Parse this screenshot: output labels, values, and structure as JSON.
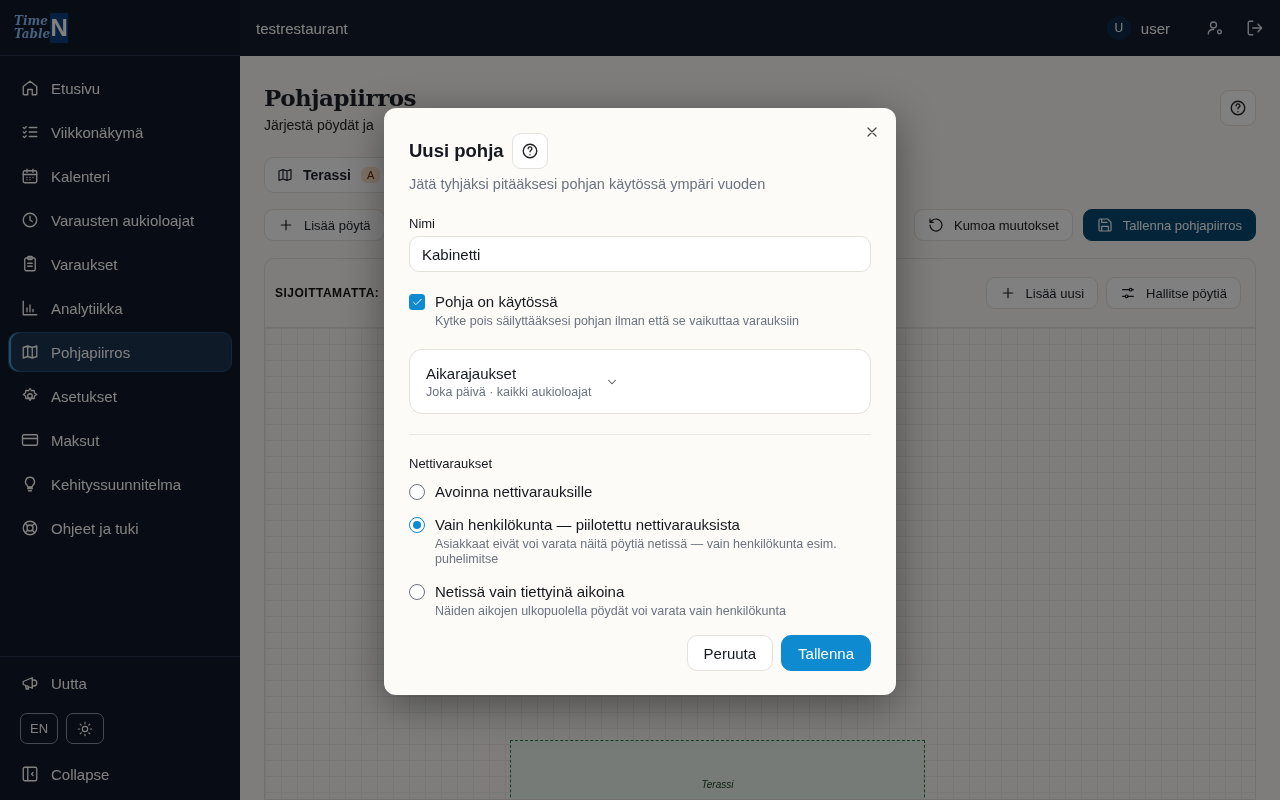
{
  "sidebar": {
    "logo": {
      "script": [
        "Time",
        "Table"
      ],
      "letter": "N"
    },
    "nav": [
      {
        "label": "Etusivu",
        "selected": false
      },
      {
        "label": "Viikkonäkymä",
        "selected": false
      },
      {
        "label": "Kalenteri",
        "selected": false
      },
      {
        "label": "Varausten aukioloajat",
        "selected": false
      },
      {
        "label": "Varaukset",
        "selected": false
      },
      {
        "label": "Analytiikka",
        "selected": false
      },
      {
        "label": "Pohjapiirros",
        "selected": true
      },
      {
        "label": "Asetukset",
        "selected": false
      },
      {
        "label": "Maksut",
        "selected": false
      },
      {
        "label": "Kehityssuunnitelma",
        "selected": false
      },
      {
        "label": "Ohjeet ja tuki",
        "selected": false
      }
    ],
    "footer": {
      "news": "Uutta",
      "language": "EN",
      "collapse": "Collapse"
    }
  },
  "topbar": {
    "restaurant": "testrestaurant",
    "avatar": "U",
    "user": "user"
  },
  "page": {
    "title": "Pohjapiirros",
    "subtitle": "Järjestä pöydät ja",
    "floor_tab": {
      "label": "Terassi",
      "badge": "A"
    },
    "toolbar": {
      "add_table": "Lisää pöytä",
      "undo": "Kumoa muutokset",
      "save": "Tallenna pohjapiirros"
    },
    "panel": {
      "unplaced": "SIJOITTAMATTA:",
      "add_new": "Lisää uusi",
      "manage": "Hallitse pöytiä",
      "zone": "Terassi"
    }
  },
  "dialog": {
    "title": "Uusi pohja",
    "description": "Jätä tyhjäksi pitääksesi pohjan käytössä ympäri vuoden",
    "name_label": "Nimi",
    "name_value": "Kabinetti",
    "enabled": {
      "label": "Pohja on käytössä",
      "hint": "Kytke pois säilyttääksesi pohjan ilman että se vaikuttaa varauksiin",
      "checked": true
    },
    "time_limits": {
      "title": "Aikarajaukset",
      "summary": "Joka päivä · kaikki aukioloajat",
      "expanded": false
    },
    "online": {
      "title": "Nettivaraukset",
      "options": [
        {
          "label": "Avoinna nettivarauksille",
          "selected": false
        },
        {
          "label": "Vain henkilökunta — piilotettu nettivarauksista",
          "hint": "Asiakkaat eivät voi varata näitä pöytiä netissä — vain henkilökunta esim. puhelimitse",
          "selected": true
        },
        {
          "label": "Netissä vain tiettyinä aikoina",
          "hint": "Näiden aikojen ulkopuolella pöydät voi varata vain henkilökunta",
          "selected": false
        }
      ]
    },
    "buttons": {
      "cancel": "Peruuta",
      "save": "Tallenna"
    }
  }
}
